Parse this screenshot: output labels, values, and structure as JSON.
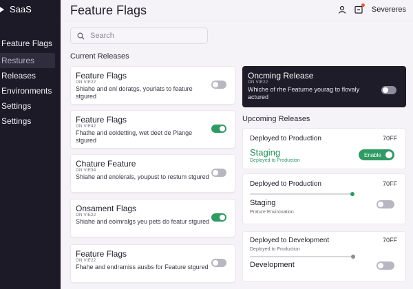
{
  "brand": {
    "name": "SaaS"
  },
  "sidebar": {
    "items": [
      {
        "label": "Feature Flags"
      },
      {
        "label": "Restures"
      },
      {
        "label": "Releases"
      },
      {
        "label": "Environments"
      },
      {
        "label": "Settings"
      },
      {
        "label": "Settings"
      }
    ]
  },
  "header": {
    "title": "Feature Flags",
    "user_icon": "user-icon",
    "notification_icon": "notification-icon",
    "user_name": "Severeres"
  },
  "search": {
    "placeholder": "Search",
    "value": ""
  },
  "current_releases": {
    "title": "Current Releases",
    "cards": [
      {
        "title": "Feature Flags",
        "version": "ON VIE22",
        "desc": "Shiahe and enl doratgs, yourlats to feature stgured",
        "toggle": "off"
      },
      {
        "title": "Feature Flags",
        "version": "ON VIE42",
        "desc": "Fhathe and eoldetting, wet deet de Plange stgured",
        "toggle": "on"
      },
      {
        "title": "Chature Feature",
        "version": "ON VIE34",
        "desc": "Shiahe and enolerals, youpust to restum stgured",
        "toggle": "off"
      },
      {
        "title": "Onsament Flags",
        "version": "ON VIE22",
        "desc": "Shiahe and eoimralgs yeu pets do featur stgured",
        "toggle": "on"
      },
      {
        "title": "Feature Flags",
        "version": "ON VIE22",
        "desc": "Fhahe and endramiss ausbs for Feature stgured",
        "toggle": "off"
      }
    ]
  },
  "upcoming_release": {
    "title": "Oncming Release",
    "version": "ON VIE22",
    "desc": "Whiche of rhe Featurne yourag to flovaly actured",
    "toggle": "off"
  },
  "upcoming_releases": {
    "title": "Upcoming Releases",
    "card1": {
      "heading": "Deployed to Production",
      "status": "70FF",
      "env_name": "Staging",
      "env_sub": "Deployed to Production",
      "button_label": "Enable"
    },
    "card2": {
      "heading": "Deployed to Production",
      "status": "70FF",
      "slider_value": 0.99,
      "env_name": "Staging",
      "env_sub": "Prature Environation",
      "toggle": "off"
    },
    "card3": {
      "heading": "Deployed to Development",
      "status": "70FF",
      "env_sub": "Deployed to Production",
      "slider_value": 1.0,
      "env_name": "Development",
      "toggle": "off"
    }
  },
  "colors": {
    "sidebar_bg": "#1c1a27",
    "accent_green": "#2f9a63",
    "dark_card": "#1f1c2a",
    "notification_dot": "#e25b3f"
  }
}
